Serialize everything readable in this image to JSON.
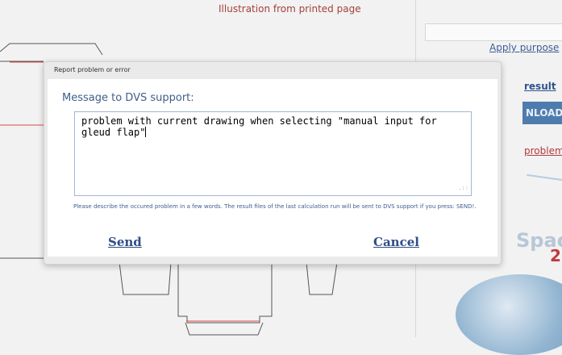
{
  "background": {
    "illustration_title": "Illustration from printed page",
    "apply_link": "Apply purpose",
    "result_link": "result",
    "download_label": "NLOAD",
    "problem_link": "problem",
    "logo_text": "Spac",
    "logo_number": "2"
  },
  "dialog": {
    "title": "Report problem or error",
    "heading": "Message to DVS support:",
    "message": "problem with current drawing when selecting \"manual input for\ngleud flap\"",
    "help_text": "Please describe the occured problem in a few words. The result files of the last calculation run will be sent to DVS support if you press: SEND!.",
    "send_label": "Send",
    "cancel_label": "Cancel"
  },
  "colors": {
    "link_blue": "#2f4d86",
    "heading_blue": "#3e5f8a",
    "title_red": "#a3413d"
  }
}
